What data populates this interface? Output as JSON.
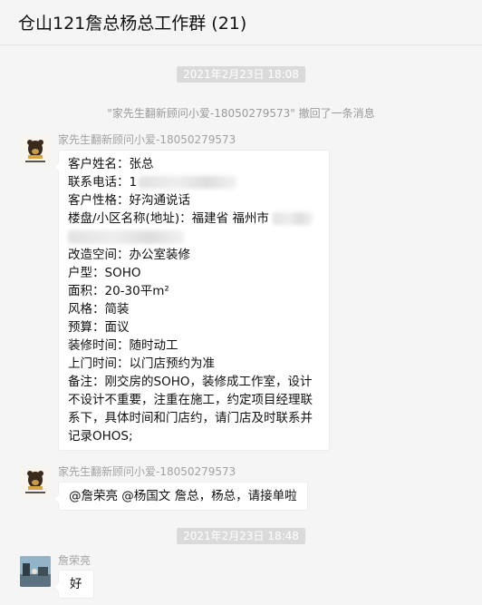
{
  "header": {
    "title": "仓山121詹总杨总工作群 (21)"
  },
  "timestamps": [
    "2021年2月23日 18:08",
    "2021年2月23日 18:48"
  ],
  "system_message": "\"家先生翻新顾问小爱-18050279573\" 撤回了一条消息",
  "messages": [
    {
      "sender": "家先生翻新顾问小爱-18050279573",
      "avatar_icon": "company-logo-avatar",
      "lines": [
        "客户姓名：张总",
        "联系电话：1",
        "客户性格：好沟通说话",
        "楼盘/小区名称(地址)：福建省 福州市",
        "改造空间：办公室装修",
        "户型：SOHO",
        "面积：20-30平m²",
        "风格：简装",
        "预算：面议",
        "装修时间：随时动工",
        "上门时间：以门店预约为准"
      ],
      "note": "备注：刚交房的SOHO，装修成工作室，设计不设计不重要，注重在施工，约定项目经理联系下，具体时间和门店约，请门店及时联系并记录OHOS;"
    },
    {
      "sender": "家先生翻新顾问小爱-18050279573",
      "avatar_icon": "company-logo-avatar",
      "text": "@詹荣亮 @杨国文 詹总，杨总，请接单啦"
    },
    {
      "sender": "詹荣亮",
      "avatar_icon": "photo-avatar",
      "text": "好"
    }
  ],
  "colors": {
    "background": "#f5f5f5",
    "bubble": "#ffffff",
    "badge": "#dadada",
    "meta_text": "#a2a2a2"
  }
}
